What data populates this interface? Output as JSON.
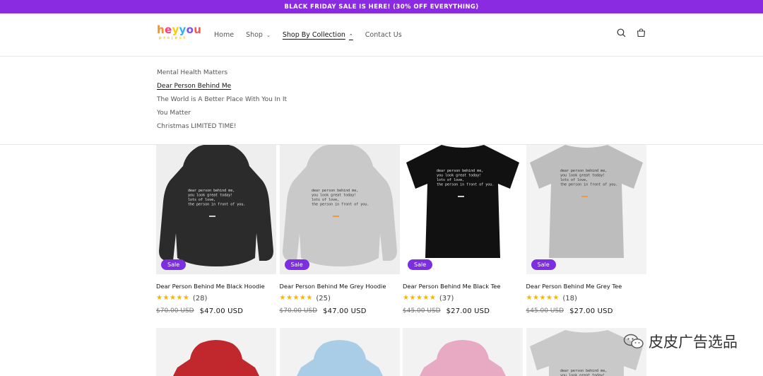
{
  "announcement": "BLACK FRIDAY SALE IS HERE! (30% OFF EVERYTHING)",
  "logo": {
    "main_letters": [
      "h",
      "e",
      "y",
      "y",
      "o",
      "u"
    ],
    "sub": "project"
  },
  "nav": {
    "home": "Home",
    "shop": "Shop",
    "shop_by_collection": "Shop By Collection",
    "contact": "Contact Us"
  },
  "icons": {
    "search": "search-icon",
    "cart": "cart-icon"
  },
  "dropdown": [
    {
      "label": "Mental Health Matters",
      "active": false
    },
    {
      "label": "Dear Person Behind Me",
      "active": true
    },
    {
      "label": "The World is A Better Place With You In It",
      "active": false
    },
    {
      "label": "You Matter",
      "active": false
    },
    {
      "label": "Christmas LIMITED TIME!",
      "active": false
    }
  ],
  "print_text": [
    "dear person behind me,",
    "you look great today!",
    "lots of love,",
    "the person in front of you."
  ],
  "products": [
    {
      "title": "Dear Person Behind Me Black Hoodie",
      "badge": "Sale",
      "rating": 5,
      "count": "(28)",
      "old_price": "$70.00 USD",
      "price": "$47.00 USD",
      "color": "#2b2b2b",
      "type": "hoodie",
      "bg": "#eeeeee"
    },
    {
      "title": "Dear Person Behind Me Grey Hoodie",
      "badge": "Sale",
      "rating": 5,
      "count": "(25)",
      "old_price": "$70.00 USD",
      "price": "$47.00 USD",
      "color": "#c9c9c9",
      "type": "hoodie",
      "bg": "#eeeeee"
    },
    {
      "title": "Dear Person Behind Me Black Tee",
      "badge": "Sale",
      "rating": 5,
      "count": "(37)",
      "old_price": "$45.00 USD",
      "price": "$27.00 USD",
      "color": "#111111",
      "type": "tee",
      "bg": "#ffffff"
    },
    {
      "title": "Dear Person Behind Me Grey Tee",
      "badge": "Sale",
      "rating": 5,
      "count": "(18)",
      "old_price": "$45.00 USD",
      "price": "$27.00 USD",
      "color": "#bdbdbd",
      "type": "tee",
      "bg": "#f3f3f3"
    }
  ],
  "row2_colors": [
    "#c0282d",
    "#a9cde6",
    "#e8a9c2",
    "#c9c9c9"
  ],
  "watermark": "皮皮广告选品"
}
